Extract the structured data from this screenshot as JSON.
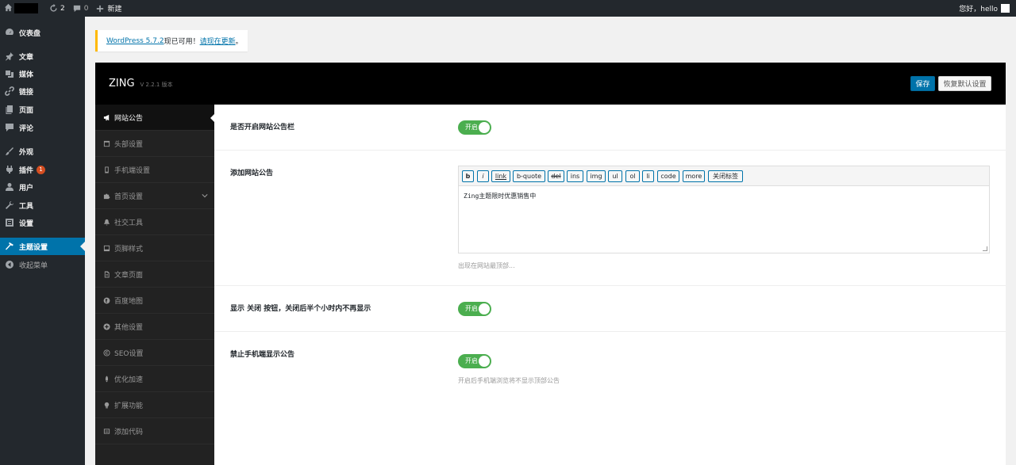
{
  "adminbar": {
    "updates_count": "2",
    "comments_count": "0",
    "new_label": "新建",
    "greeting": "您好，hello"
  },
  "menu": {
    "items": [
      {
        "label": "仪表盘",
        "icon": "dashboard-icon"
      },
      {
        "label": "文章",
        "icon": "pushpin-icon"
      },
      {
        "label": "媒体",
        "icon": "media-icon"
      },
      {
        "label": "链接",
        "icon": "link-icon"
      },
      {
        "label": "页面",
        "icon": "page-icon"
      },
      {
        "label": "评论",
        "icon": "comment-icon"
      },
      {
        "label": "外观",
        "icon": "brush-icon"
      },
      {
        "label": "插件",
        "icon": "plugin-icon",
        "badge": "1"
      },
      {
        "label": "用户",
        "icon": "user-icon"
      },
      {
        "label": "工具",
        "icon": "wrench-icon"
      },
      {
        "label": "设置",
        "icon": "settings-icon"
      },
      {
        "label": "主题设置",
        "icon": "hammer-icon",
        "current": true
      },
      {
        "label": "收起菜单",
        "icon": "collapse-icon"
      }
    ]
  },
  "notice": {
    "link1": "WordPress 5.7.2",
    "text1": "现已可用！",
    "link2": "请现在更新",
    "text2": "。"
  },
  "panel": {
    "brand": "ZING",
    "version": "V 2.2.1 版本",
    "save_label": "保存",
    "reset_label": "恢复默认设置"
  },
  "nav": {
    "items": [
      {
        "label": "网站公告",
        "icon": "megaphone-icon",
        "active": true
      },
      {
        "label": "头部设置",
        "icon": "header-icon"
      },
      {
        "label": "手机端设置",
        "icon": "mobile-icon"
      },
      {
        "label": "首页设置",
        "icon": "puzzle-icon",
        "chevron": true
      },
      {
        "label": "社交工具",
        "icon": "bell-icon"
      },
      {
        "label": "页脚样式",
        "icon": "footer-icon"
      },
      {
        "label": "文章页面",
        "icon": "document-icon"
      },
      {
        "label": "百度地图",
        "icon": "globe-icon"
      },
      {
        "label": "其他设置",
        "icon": "plus-circle-icon"
      },
      {
        "label": "SEO设置",
        "icon": "copyright-icon"
      },
      {
        "label": "优化加速",
        "icon": "rocket-icon"
      },
      {
        "label": "扩展功能",
        "icon": "lightbulb-icon"
      },
      {
        "label": "添加代码",
        "icon": "code-icon"
      }
    ]
  },
  "fields": {
    "f1": {
      "title": "是否开启网站公告栏",
      "switch_label": "开启"
    },
    "f2": {
      "title": "添加网站公告",
      "toolbar": [
        "b",
        "i",
        "link",
        "b-quote",
        "del",
        "ins",
        "img",
        "ul",
        "ol",
        "li",
        "code",
        "more",
        "关闭标签"
      ],
      "content": "Zing主题限时优惠销售中",
      "help": "出现在网站最顶部..."
    },
    "f3": {
      "title": "显示 关闭 按钮，关闭后半个小时内不再显示",
      "switch_label": "开启"
    },
    "f4": {
      "title": "禁止手机端显示公告",
      "switch_label": "开启",
      "help": "开启后手机端浏览将不显示顶部公告"
    }
  },
  "colors": {
    "admin_dark": "#23282d",
    "accent_blue": "#0073aa",
    "switch_green": "#4bae4f",
    "notice_yellow": "#ffb900"
  }
}
